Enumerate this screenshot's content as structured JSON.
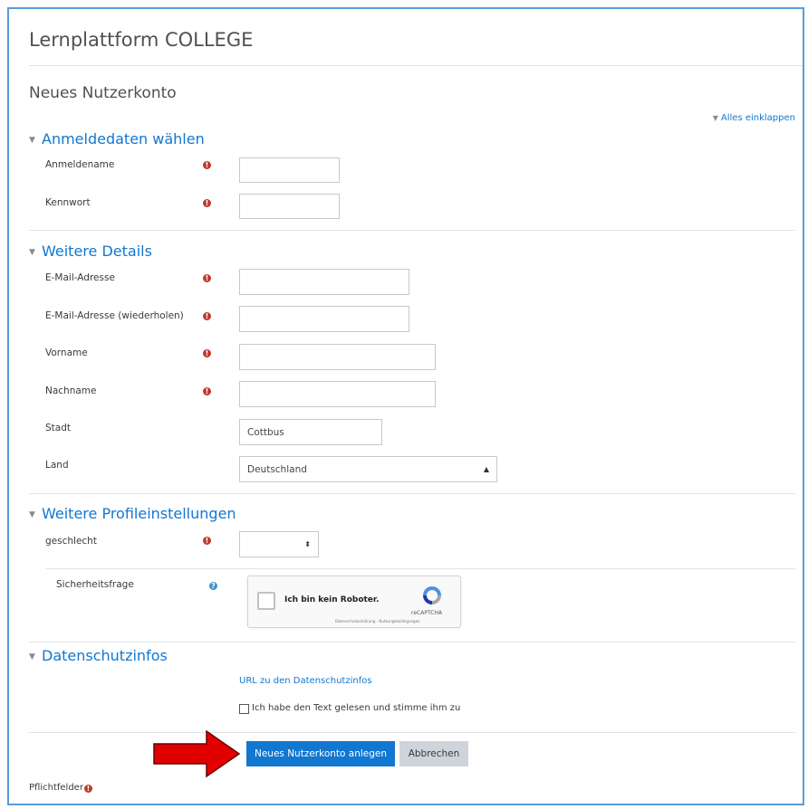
{
  "site": {
    "title": "Lernplattform COLLEGE"
  },
  "page": {
    "title": "Neues Nutzerkonto"
  },
  "collapse_all": "Alles einklappen",
  "sections": {
    "login": {
      "title": "Anmeldedaten wählen",
      "username_label": "Anmeldename",
      "password_label": "Kennwort"
    },
    "details": {
      "title": "Weitere Details",
      "email_label": "E-Mail-Adresse",
      "email2_label": "E-Mail-Adresse (wiederholen)",
      "firstname_label": "Vorname",
      "lastname_label": "Nachname",
      "city_label": "Stadt",
      "city_value": "Cottbus",
      "country_label": "Land",
      "country_value": "Deutschland"
    },
    "profile": {
      "title": "Weitere Profileinstellungen",
      "gender_label": "geschlecht",
      "gender_value": "",
      "security_label": "Sicherheitsfrage"
    },
    "privacy": {
      "title": "Datenschutzinfos",
      "url_link": "URL zu den Datenschutzinfos",
      "agree_label": "Ich habe den Text gelesen und stimme ihm zu"
    }
  },
  "recaptcha": {
    "label": "Ich bin kein Roboter.",
    "brand": "reCAPTCHA",
    "links": "Datenschutzerklärung - Nutzungsbedingungen"
  },
  "buttons": {
    "submit": "Neues Nutzerkonto anlegen",
    "cancel": "Abbrechen"
  },
  "footer": {
    "required_label": "Pflichtfelder"
  },
  "icons": {
    "required": "exclamation-circle-icon",
    "help": "question-circle-icon",
    "collapse": "triangle-down-icon",
    "annotation": "red-arrow-icon"
  },
  "colors": {
    "link": "#1177d1",
    "required": "#c0392b",
    "primary_button": "#1177d1",
    "secondary_button": "#ced4da",
    "frame": "#5b9bd5",
    "annotation_arrow": "#e00000"
  }
}
